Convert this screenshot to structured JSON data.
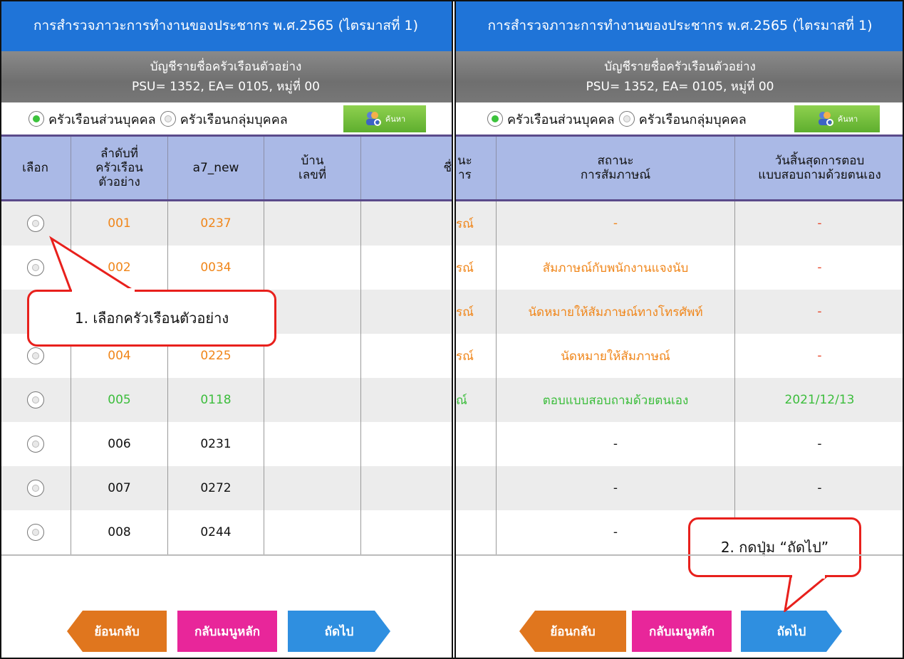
{
  "title": "การสำรวจภาวะการทำงานของประชากร พ.ศ.2565 (ไตรมาสที่ 1)",
  "subtitle_line1": "บัญชีรายชื่อครัวเรือนตัวอย่าง",
  "subtitle_line2": "PSU= 1352, EA= 0105, หมู่ที่ 00",
  "radio_private": "ครัวเรือนส่วนบุคคล",
  "radio_group": "ครัวเรือนกลุ่มบุคคล",
  "search_label": "ค้นหา",
  "left_headers": [
    "เลือก",
    "ลำดับที่\nครัวเรือน\nตัวอย่าง",
    "a7_new",
    "บ้าน\nเลขที่",
    "",
    "ชื่"
  ],
  "right_headers": [
    "นะ\nาร",
    "สถานะ\nการสัมภาษณ์",
    "วันสิ้นสุดการตอบ\nแบบสอบถามด้วยตนเอง"
  ],
  "rows": [
    {
      "seq": "001",
      "a7": "0237",
      "prev": "รณ์",
      "status": "-",
      "end": "-",
      "color": "orange"
    },
    {
      "seq": "002",
      "a7": "0034",
      "prev": "รณ์",
      "status": "สัมภาษณ์กับพนักงานแจงนับ",
      "end": "-",
      "color": "orange"
    },
    {
      "seq": "",
      "a7": "",
      "prev": "รณ์",
      "status": "นัดหมายให้สัมภาษณ์ทางโทรศัพท์",
      "end": "-",
      "color": "orange"
    },
    {
      "seq": "004",
      "a7": "0225",
      "prev": "รณ์",
      "status": "นัดหมายให้สัมภาษณ์",
      "end": "-",
      "color": "orange"
    },
    {
      "seq": "005",
      "a7": "0118",
      "prev": "ณ์",
      "status": "ตอบแบบสอบถามด้วยตนเอง",
      "end": "2021/12/13",
      "color": "green"
    },
    {
      "seq": "006",
      "a7": "0231",
      "prev": "",
      "status": "-",
      "end": "-",
      "color": "black"
    },
    {
      "seq": "007",
      "a7": "0272",
      "prev": "",
      "status": "-",
      "end": "-",
      "color": "black"
    },
    {
      "seq": "008",
      "a7": "0244",
      "prev": "",
      "status": "-",
      "end": "",
      "color": "black"
    }
  ],
  "buttons": {
    "back": "ย้อนกลับ",
    "main_menu": "กลับเมนูหลัก",
    "next": "ถัดไป"
  },
  "callout1": "1. เลือกครัวเรือนตัวอย่าง",
  "callout2": "2. กดปุ่ม “ถัดไป”",
  "colors": {
    "title_bg": "#1f74d8",
    "orange": "#f0861a",
    "green": "#3cbd3c",
    "back_btn": "#e0761e",
    "menu_btn": "#e8269a",
    "next_btn": "#2f8fe0",
    "callout_border": "#e8201c"
  }
}
